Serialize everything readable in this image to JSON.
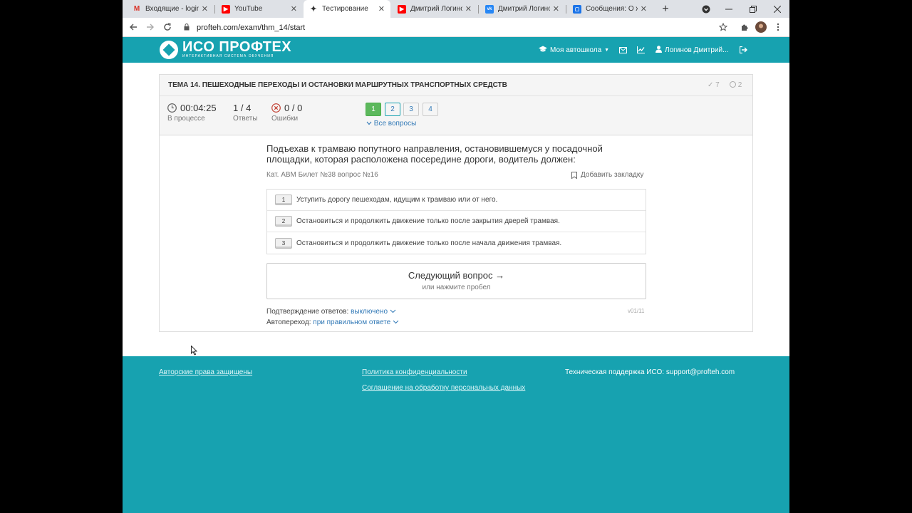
{
  "browser": {
    "tabs": [
      {
        "label": "Входящие - loginov",
        "icon": "gmail-icon",
        "color": "#d93025",
        "glyph": "M"
      },
      {
        "label": "YouTube",
        "icon": "youtube-icon",
        "color": "#ff0000",
        "glyph": "▶"
      },
      {
        "label": "Тестирование",
        "icon": "profteh-icon",
        "color": "#333333",
        "glyph": "✦"
      },
      {
        "label": "Дмитрий Логинов",
        "icon": "youtube-icon",
        "color": "#ff0000",
        "glyph": "▶"
      },
      {
        "label": "Дмитрий Логинов",
        "icon": "vk-icon",
        "color": "#2787f5",
        "glyph": "vk"
      },
      {
        "label": "Сообщения: О жиз",
        "icon": "messages-icon",
        "color": "#1a73e8",
        "glyph": "▢"
      }
    ],
    "close_glyph": "✕",
    "new_tab_glyph": "+",
    "url": "profteh.com/exam/thm_14/start"
  },
  "site": {
    "logo_title": "ИСО ПРОФТЕХ",
    "logo_subtitle": "ИНТЕРАКТИВНАЯ СИСТЕМА ОБУЧЕНИЯ",
    "nav_school": "Моя автошкола",
    "user": "Логинов Дмитрий...",
    "accent_color": "#17a2b0"
  },
  "exam": {
    "title": "ТЕМА 14. ПЕШЕХОДНЫЕ ПЕРЕХОДЫ И ОСТАНОВКИ МАРШРУТНЫХ ТРАНСПОРТНЫХ СРЕДСТВ",
    "correct_count": "7",
    "skipped_count": "2",
    "timer": "00:04:25",
    "timer_label": "В процессе",
    "answers_value": "1 / 4",
    "answers_label": "Ответы",
    "errors_value": "0 / 0",
    "errors_label": "Ошибки",
    "question_numbers": [
      "1",
      "2",
      "3",
      "4"
    ],
    "all_questions": "Все вопросы",
    "question_text": "Подъехав к трамваю попутного направления, остановившемуся у посадочной площадки, которая расположена посередине дороги, водитель должен:",
    "question_meta": "Кат. ABM  Билет №38  вопрос №16",
    "bookmark": "Добавить закладку",
    "answers": [
      {
        "num": "1",
        "text": "Уступить дорогу пешеходам, идущим к трамваю или от него."
      },
      {
        "num": "2",
        "text": "Остановиться и продолжить движение только после закрытия дверей трамвая."
      },
      {
        "num": "3",
        "text": "Остановиться и продолжить движение только после начала движения трамвая."
      }
    ],
    "next_label": "Следующий вопрос →",
    "next_hint": "или нажмите пробел",
    "confirm_label": "Подтверждение ответов:",
    "confirm_value": "выключено",
    "auto_label": "Автопереход:",
    "auto_value": "при правильном ответе",
    "version": "v01/11"
  },
  "footer": {
    "copyright": "Авторские права защищены",
    "privacy": "Политика конфиденциальности",
    "agreement": "Соглашение на обработку персональных данных",
    "support_label": "Техническая поддержка ИСО:",
    "support_email": "support@profteh.com"
  }
}
